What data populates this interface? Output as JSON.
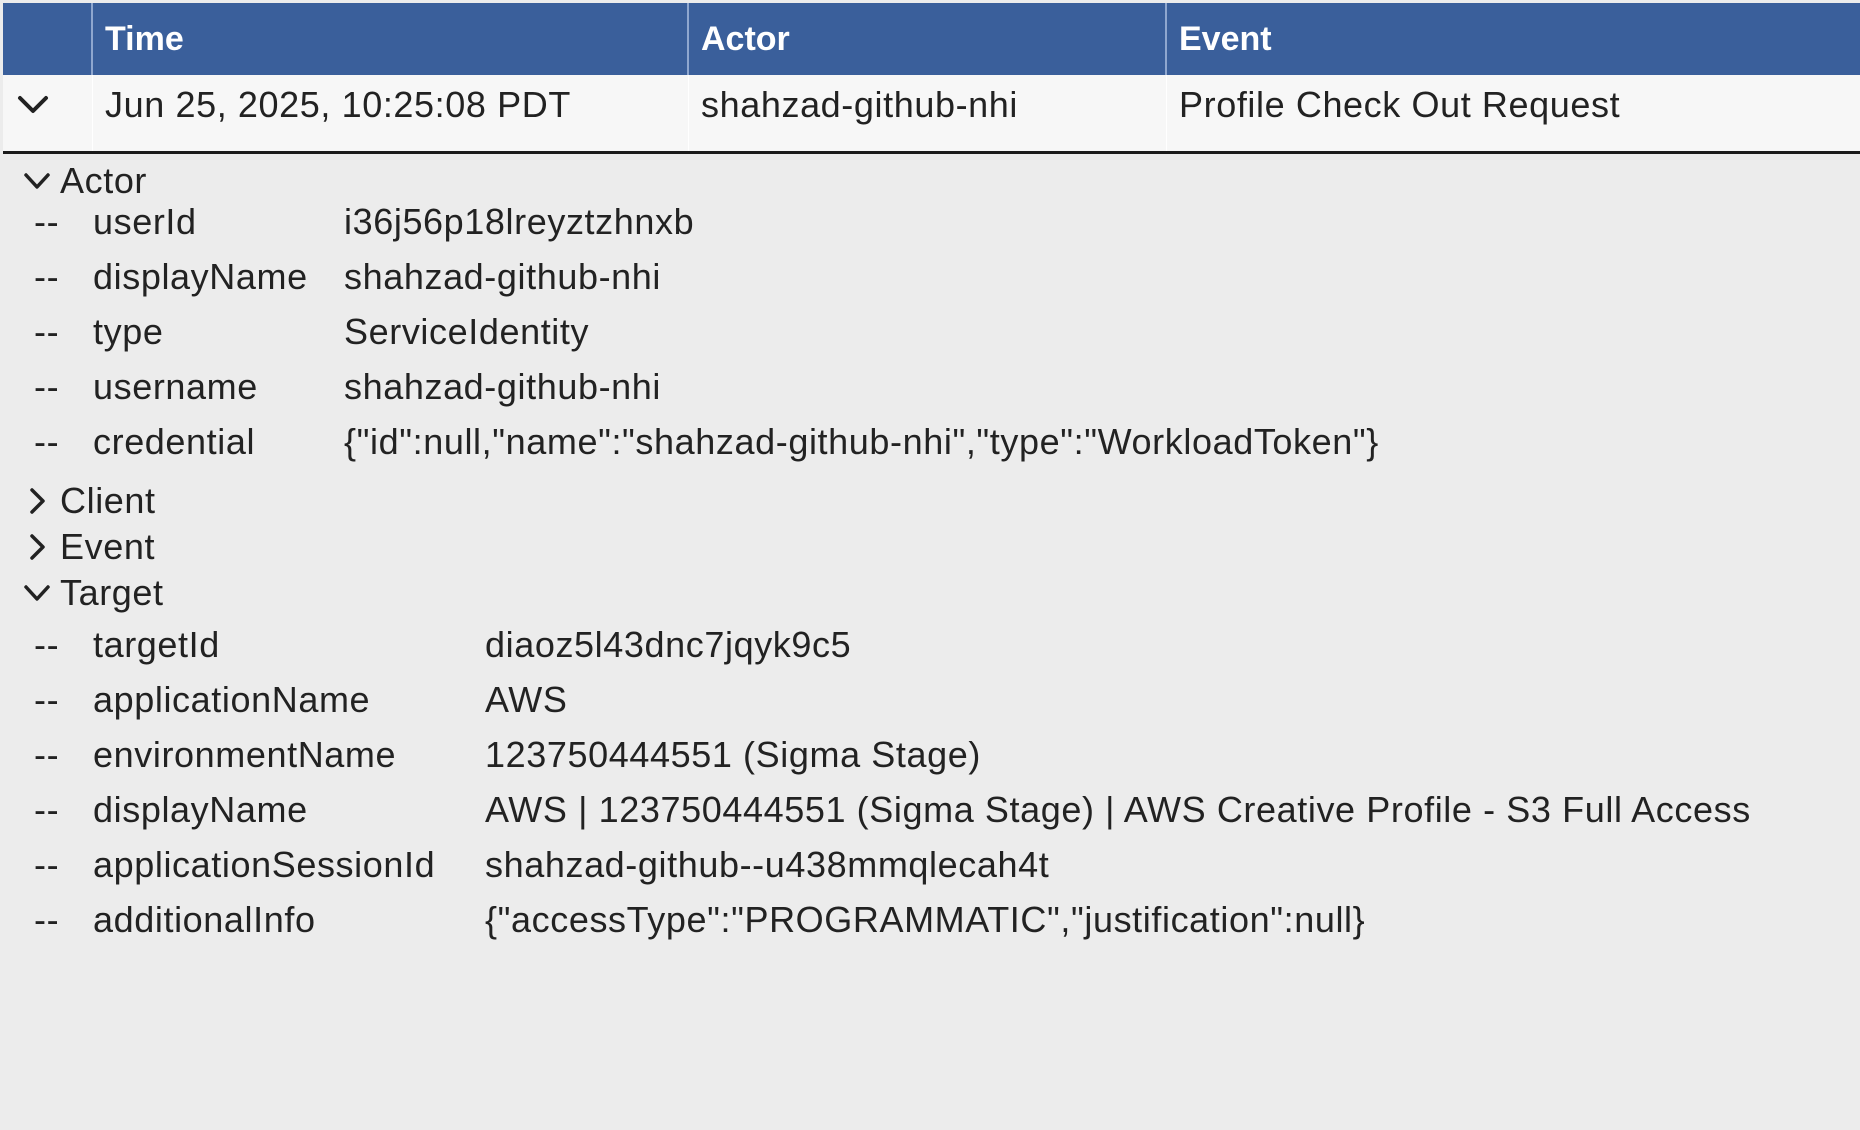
{
  "table": {
    "columns": {
      "time": "Time",
      "actor": "Actor",
      "event": "Event"
    },
    "row": {
      "time": "Jun 25, 2025, 10:25:08 PDT",
      "actor": "shahzad-github-nhi",
      "event": "Profile Check Out Request",
      "expanded": true
    }
  },
  "details": {
    "dash": "--",
    "actor": {
      "label": "Actor",
      "expanded": true,
      "fields": [
        {
          "key": "userId",
          "value": "i36j56p18lreyztzhnxb"
        },
        {
          "key": "displayName",
          "value": "shahzad-github-nhi"
        },
        {
          "key": "type",
          "value": "ServiceIdentity"
        },
        {
          "key": "username",
          "value": "shahzad-github-nhi"
        },
        {
          "key": "credential",
          "value": "{\"id\":null,\"name\":\"shahzad-github-nhi\",\"type\":\"WorkloadToken\"}"
        }
      ]
    },
    "client": {
      "label": "Client",
      "expanded": false
    },
    "event": {
      "label": "Event",
      "expanded": false
    },
    "target": {
      "label": "Target",
      "expanded": true,
      "fields": [
        {
          "key": "targetId",
          "value": "diaoz5l43dnc7jqyk9c5"
        },
        {
          "key": "applicationName",
          "value": "AWS"
        },
        {
          "key": "environmentName",
          "value": "123750444551 (Sigma Stage)"
        },
        {
          "key": "displayName",
          "value": "AWS | 123750444551 (Sigma Stage) | AWS Creative Profile - S3 Full Access"
        },
        {
          "key": "applicationSessionId",
          "value": "shahzad-github--u438mmqlecah4t"
        },
        {
          "key": "additionalInfo",
          "value": "{\"accessType\":\"PROGRAMMATIC\",\"justification\":null}"
        }
      ]
    }
  },
  "colors": {
    "header_bg": "#3a5f9b",
    "header_text": "#ffffff",
    "row_bg": "#f7f7f7",
    "detail_bg": "#ececec"
  }
}
